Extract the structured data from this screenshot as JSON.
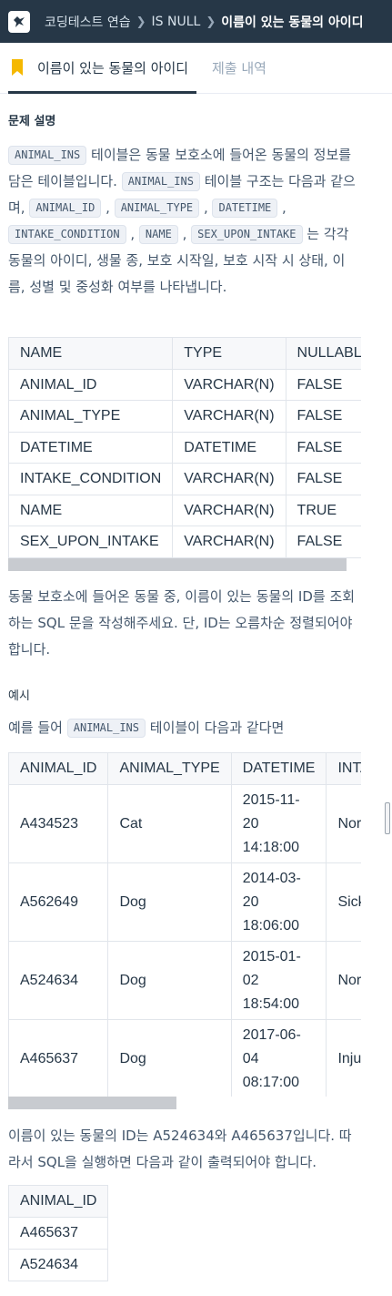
{
  "header": {
    "breadcrumb": [
      "코딩테스트 연습",
      "IS NULL"
    ],
    "current": "이름이 있는 동물의 아이디"
  },
  "tabs": {
    "active": "이름이 있는 동물의 아이디",
    "other": "제출 내역"
  },
  "section_title": "문제 설명",
  "intro": {
    "t1": " 테이블은 동물 보호소에 들어온 동물의 정보를 담은 테이블입니다. ",
    "t2": " 테이블 구조는 다음과 같으며, ",
    "t3": " 는 각각 동물의 아이디, 생물 종, 보호 시작일, 보호 시작 시 상태, 이름, 성별 및 중성화 여부를 나타냅니다.",
    "codes": [
      "ANIMAL_INS",
      "ANIMAL_INS",
      "ANIMAL_ID",
      "ANIMAL_TYPE",
      "DATETIME",
      "INTAKE_CONDITION",
      "NAME",
      "SEX_UPON_INTAKE"
    ]
  },
  "schema_table": {
    "headers": [
      "NAME",
      "TYPE",
      "NULLABLE"
    ],
    "rows": [
      [
        "ANIMAL_ID",
        "VARCHAR(N)",
        "FALSE"
      ],
      [
        "ANIMAL_TYPE",
        "VARCHAR(N)",
        "FALSE"
      ],
      [
        "DATETIME",
        "DATETIME",
        "FALSE"
      ],
      [
        "INTAKE_CONDITION",
        "VARCHAR(N)",
        "FALSE"
      ],
      [
        "NAME",
        "VARCHAR(N)",
        "TRUE"
      ],
      [
        "SEX_UPON_INTAKE",
        "VARCHAR(N)",
        "FALSE"
      ]
    ]
  },
  "task": "동물 보호소에 들어온 동물 중, 이름이 있는 동물의 ID를 조회하는 SQL 문을 작성해주세요. 단, ID는 오름차순 정렬되어야 합니다.",
  "example_title": "예시",
  "example_intro": {
    "before": "예를 들어 ",
    "code": "ANIMAL_INS",
    "after": " 테이블이 다음과 같다면"
  },
  "example_table": {
    "headers": [
      "ANIMAL_ID",
      "ANIMAL_TYPE",
      "DATETIME",
      "INTAKE_CONDITION"
    ],
    "rows": [
      [
        "A434523",
        "Cat",
        "2015-11-20 14:18:00",
        "Normal"
      ],
      [
        "A562649",
        "Dog",
        "2014-03-20 18:06:00",
        "Sick"
      ],
      [
        "A524634",
        "Dog",
        "2015-01-02 18:54:00",
        "Normal"
      ],
      [
        "A465637",
        "Dog",
        "2017-06-04 08:17:00",
        "Injured"
      ]
    ]
  },
  "result_text": "이름이 있는 동물의 ID는 A524634와 A465637입니다. 따라서 SQL을 실행하면 다음과 같이 출력되어야 합니다.",
  "result_table": {
    "headers": [
      "ANIMAL_ID"
    ],
    "rows": [
      [
        "A465637"
      ],
      [
        "A524634"
      ]
    ]
  },
  "colors": {
    "header_bg": "#263747",
    "bookmark": "#f5b800",
    "code_bg": "#eef1f6"
  }
}
